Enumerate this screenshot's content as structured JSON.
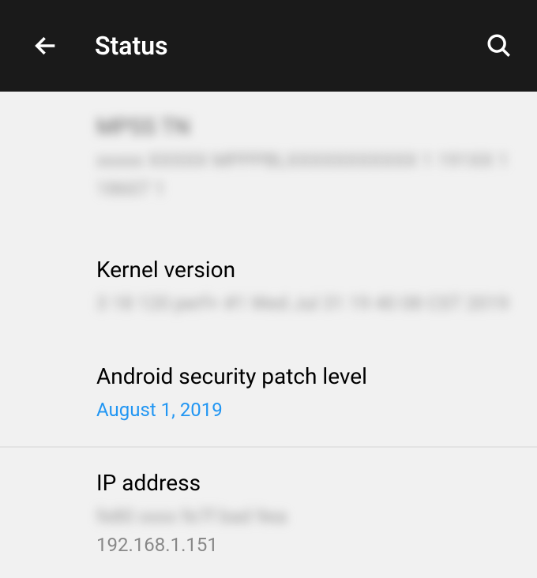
{
  "header": {
    "title": "Status"
  },
  "items": [
    {
      "title_blurred": "MPSS TN",
      "value_blurred": "xxxxx XXXXX MPPPBLXXXXXXXXXXX 1 191XX 1 18607 1"
    },
    {
      "title": "Kernel version",
      "value_blurred": "3 18 120 perf+\n#1 Wed Jul 31 19 40 08 CST 2019"
    },
    {
      "title": "Android security patch level",
      "value": "August 1, 2019",
      "link": true
    },
    {
      "title": "IP address",
      "value_blurred": "fe80 xxxx fe7f bad 9ea",
      "value": "192.168.1.151"
    }
  ]
}
